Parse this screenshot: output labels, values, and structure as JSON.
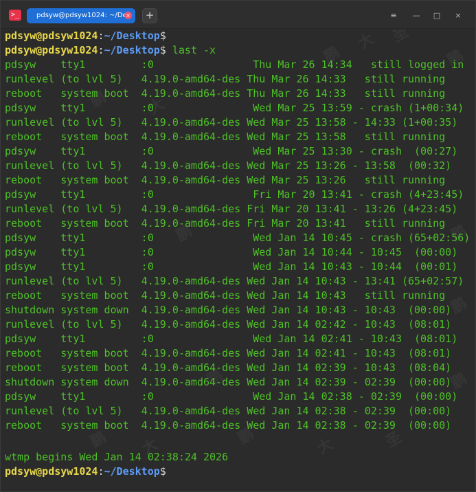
{
  "window": {
    "app_icon_glyph": ">_",
    "tab_title": "pdsyw@pdsyw1024: ~/Desktop",
    "tab_close_glyph": "×",
    "new_tab_glyph": "+",
    "menu_glyph": "≡",
    "minimize_glyph": "—",
    "maximize_glyph": "□",
    "close_glyph": "×"
  },
  "colors": {
    "prompt_user": "#e8d84a",
    "prompt_path": "#5d9cf5",
    "output_text": "#4ec127",
    "tab_active": "#1f6fd6",
    "background": "#2b2b2b"
  },
  "watermark": {
    "text_1": "鹏",
    "text_2": "大",
    "text_3": "圣"
  },
  "terminal": {
    "prompt1": {
      "user": "pdsyw@pdsyw1024",
      "colon": ":",
      "path": "~/Desktop",
      "dollar": "$",
      "command": ""
    },
    "prompt2": {
      "user": "pdsyw@pdsyw1024",
      "colon": ":",
      "path": "~/Desktop",
      "dollar": "$",
      "command": " last -x"
    },
    "rows": [
      "pdsyw    tty1         :0                Thu Mar 26 14:34   still logged in",
      "runlevel (to lvl 5)   4.19.0-amd64-des Thu Mar 26 14:33   still running",
      "reboot   system boot  4.19.0-amd64-des Thu Mar 26 14:33   still running",
      "pdsyw    tty1         :0                Wed Mar 25 13:59 - crash (1+00:34)",
      "runlevel (to lvl 5)   4.19.0-amd64-des Wed Mar 25 13:58 - 14:33 (1+00:35)",
      "reboot   system boot  4.19.0-amd64-des Wed Mar 25 13:58   still running",
      "pdsyw    tty1         :0                Wed Mar 25 13:30 - crash  (00:27)",
      "runlevel (to lvl 5)   4.19.0-amd64-des Wed Mar 25 13:26 - 13:58  (00:32)",
      "reboot   system boot  4.19.0-amd64-des Wed Mar 25 13:26   still running",
      "pdsyw    tty1         :0                Fri Mar 20 13:41 - crash (4+23:45)",
      "runlevel (to lvl 5)   4.19.0-amd64-des Fri Mar 20 13:41 - 13:26 (4+23:45)",
      "reboot   system boot  4.19.0-amd64-des Fri Mar 20 13:41   still running",
      "pdsyw    tty1         :0                Wed Jan 14 10:45 - crash (65+02:56)",
      "pdsyw    tty1         :0                Wed Jan 14 10:44 - 10:45  (00:00)",
      "pdsyw    tty1         :0                Wed Jan 14 10:43 - 10:44  (00:01)",
      "runlevel (to lvl 5)   4.19.0-amd64-des Wed Jan 14 10:43 - 13:41 (65+02:57)",
      "reboot   system boot  4.19.0-amd64-des Wed Jan 14 10:43   still running",
      "shutdown system down  4.19.0-amd64-des Wed Jan 14 10:43 - 10:43  (00:00)",
      "runlevel (to lvl 5)   4.19.0-amd64-des Wed Jan 14 02:42 - 10:43  (08:01)",
      "pdsyw    tty1         :0                Wed Jan 14 02:41 - 10:43  (08:01)",
      "reboot   system boot  4.19.0-amd64-des Wed Jan 14 02:41 - 10:43  (08:01)",
      "reboot   system boot  4.19.0-amd64-des Wed Jan 14 02:39 - 10:43  (08:04)",
      "shutdown system down  4.19.0-amd64-des Wed Jan 14 02:39 - 02:39  (00:00)",
      "pdsyw    tty1         :0                Wed Jan 14 02:38 - 02:39  (00:00)",
      "runlevel (to lvl 5)   4.19.0-amd64-des Wed Jan 14 02:38 - 02:39  (00:00)",
      "reboot   system boot  4.19.0-amd64-des Wed Jan 14 02:38 - 02:39  (00:00)"
    ],
    "wtmp_line": "wtmp begins Wed Jan 14 02:38:24 2026",
    "prompt3": {
      "user": "pdsyw@pdsyw1024",
      "colon": ":",
      "path": "~/Desktop",
      "dollar": "$",
      "command": ""
    }
  }
}
